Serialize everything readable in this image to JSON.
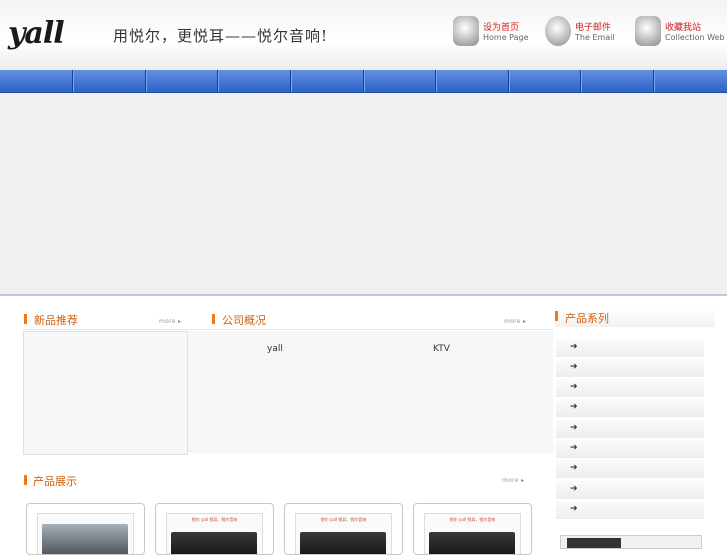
{
  "header": {
    "logo": "yall",
    "slogan": "用悦尔，更悦耳——悦尔音响!",
    "links": [
      {
        "cn": "设为首页",
        "en": "Home Page",
        "icon": "people-icon"
      },
      {
        "cn": "电子邮件",
        "en": "The Email",
        "icon": "email-icon"
      },
      {
        "cn": "收藏我站",
        "en": "Collection Web",
        "icon": "bookmark-icon"
      }
    ]
  },
  "nav": {
    "items": [
      "",
      "",
      "",
      "",
      "",
      "",
      "",
      "",
      "",
      ""
    ]
  },
  "sections": {
    "new_products": {
      "title": "新品推荐",
      "more": "more"
    },
    "about": {
      "title": "公司概况",
      "more": "more",
      "text_left": "yall",
      "text_right": "KTV"
    },
    "categories": {
      "title": "产品系列",
      "items": [
        "",
        "",
        "",
        "",
        "",
        "",
        "",
        "",
        ""
      ]
    },
    "showcase": {
      "title": "产品展示",
      "more": "more"
    }
  },
  "products": [
    {
      "caption": ""
    },
    {
      "caption": "悦尔 yall 悦耳，悦尔音响"
    },
    {
      "caption": "悦尔 yall 悦耳，悦尔音响"
    },
    {
      "caption": "悦尔 yall 悦耳，悦尔音响"
    }
  ],
  "colors": {
    "nav": "#2f62c4",
    "accent": "#f07818",
    "title": "#d06010",
    "link_red": "#d01f1f"
  }
}
